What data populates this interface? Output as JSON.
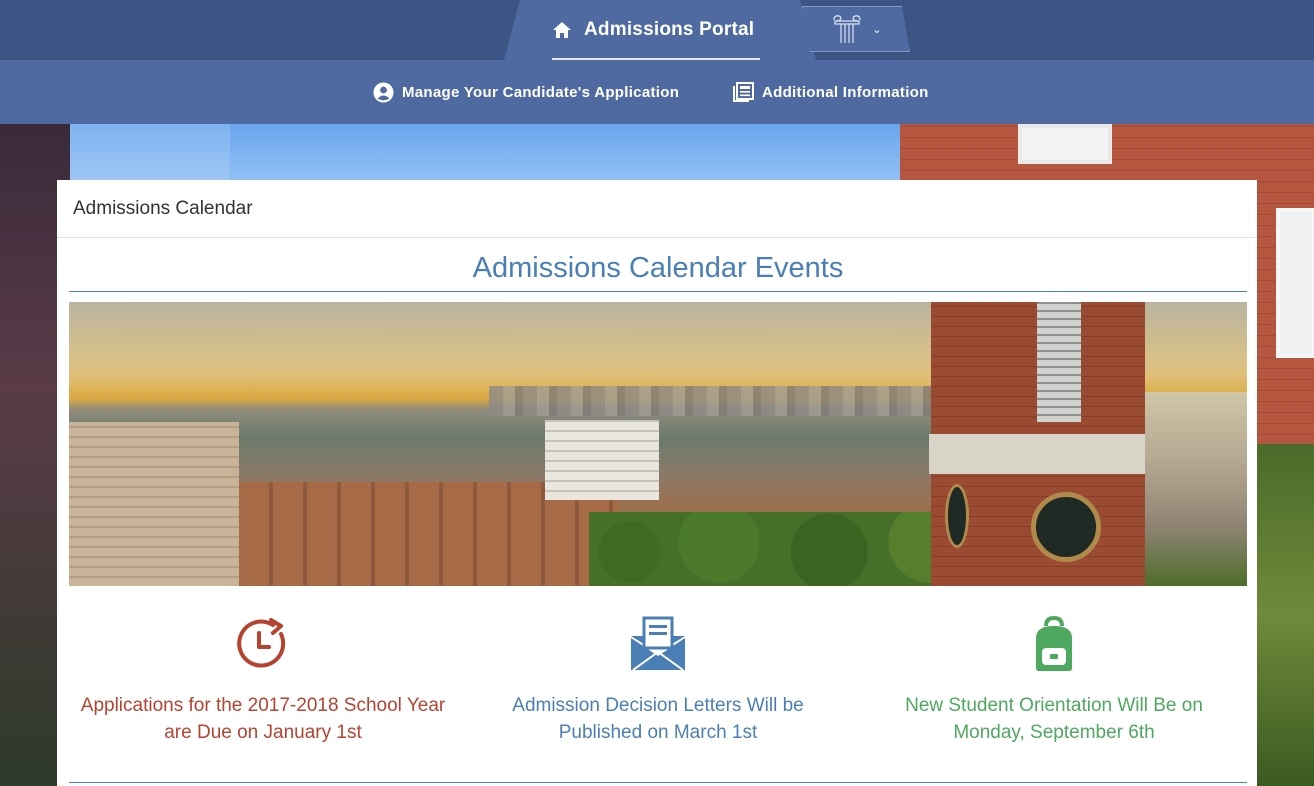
{
  "app": {
    "portal_title": "Admissions Portal",
    "home_icon": "home-icon",
    "logo_icon": "column-logo-icon",
    "account_dropdown_icon": "chevron-down-icon"
  },
  "subnav": {
    "items": [
      {
        "label": "Manage Your Candidate's Application",
        "icon": "user-circle-icon"
      },
      {
        "label": "Additional Information",
        "icon": "newspaper-icon"
      }
    ]
  },
  "card": {
    "header": "Admissions Calendar",
    "events_title": "Admissions Calendar Events"
  },
  "events": [
    {
      "text": "Applications for the 2017-2018 School Year\nare Due on January 1st",
      "icon": "clock-arrow-icon",
      "color": "#b5432f"
    },
    {
      "text": "Admission Decision Letters Will be\nPublished on March 1st",
      "icon": "open-envelope-icon",
      "color": "#4a7fb5"
    },
    {
      "text": "New Student Orientation Will Be on\nMonday, September 6th",
      "icon": "backpack-icon",
      "color": "#4fa85f"
    }
  ],
  "colors": {
    "topbar": "#3d5584",
    "subnav": "#4e6aa1",
    "title_blue": "#4a7fb5"
  }
}
